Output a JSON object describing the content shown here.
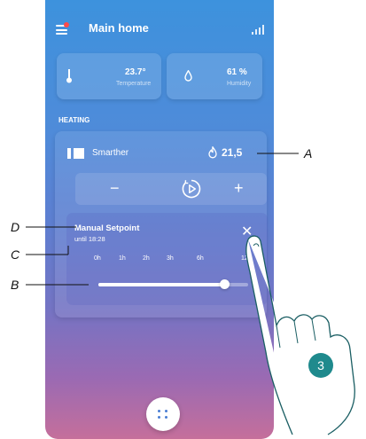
{
  "header": {
    "title": "Main home"
  },
  "sensors": {
    "temperature": {
      "value": "23.7°",
      "label": "Temperature"
    },
    "humidity": {
      "value": "61 %",
      "label": "Humidity"
    }
  },
  "heating": {
    "section_label": "HEATING",
    "device_name": "Smarther",
    "current_temp": "21,5",
    "controls": {
      "minus": "−",
      "plus": "+"
    },
    "manual": {
      "title": "Manual Setpoint",
      "until": "until 18:28",
      "close": "✕",
      "timeline": [
        "0h",
        "1h",
        "2h",
        "3h",
        "6h",
        "12h"
      ],
      "slider_level": 0.84
    }
  },
  "annotations": {
    "A": "A",
    "B": "B",
    "C": "C",
    "D": "D",
    "step": "3"
  },
  "colors": {
    "gradient_top": "#3d92dd",
    "gradient_bottom": "#c56f9b",
    "badge": "#1f8a8d",
    "notification_dot": "#ff4a4a"
  },
  "icons": [
    "menu-icon",
    "signal-icon",
    "thermometer-icon",
    "droplet-icon",
    "device-icon",
    "flame-icon",
    "play-icon",
    "close-icon",
    "apps-icon",
    "hand-icon"
  ]
}
